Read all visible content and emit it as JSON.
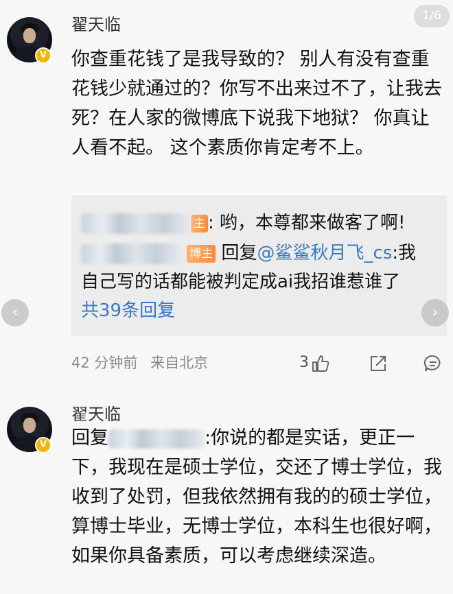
{
  "pager": {
    "label": "1/6"
  },
  "comments": [
    {
      "username": "翟天临",
      "verified_icon": "v-badge-icon",
      "text": "你查重花钱了是我导致的？ 别人有没有查重花钱少就通过的？你写不出来过不了，让我去死？在人家的微博底下说我下地狱？ 你真让人看不起。 这个素质你肯定考不上。",
      "replies": [
        {
          "tag": "主",
          "text": ": 哟，本尊都来做客了啊!"
        },
        {
          "tag": "博主",
          "prefix": "回复",
          "mention": "@鲨鲨秋月飞_cs",
          "text": ":我自己写的话都能被判定成ai我招谁惹谁了"
        }
      ],
      "more_replies": "共39条回复",
      "time": "42 分钟前",
      "source": "来自北京",
      "like_count": "3"
    },
    {
      "username": "翟天临",
      "verified_icon": "v-badge-icon",
      "reply_prefix": "回复",
      "text": ":你说的都是实话，更正一下，我现在是硕士学位，交还了博士学位，我收到了处罚，但我依然拥有我的的硕士学位，算博士毕业，无博士学位，本科生也很好啊，如果你具备素质，可以考虑继续深造。"
    }
  ],
  "nav": {
    "left": "‹",
    "right": "›"
  },
  "colors": {
    "link": "#3a78c3",
    "tag": "#ff8a3d",
    "badge": "#f5b400"
  }
}
